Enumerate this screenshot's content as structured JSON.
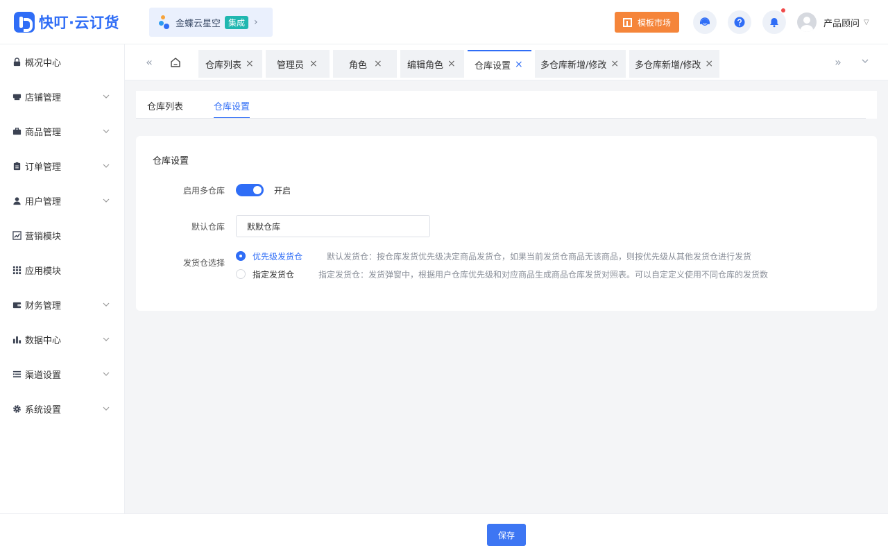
{
  "header": {
    "brand": "快叮·云订货",
    "integration": {
      "name": "金蝶云星空",
      "badge": "集成"
    },
    "template_market": "模板市场",
    "user_name": "产品顾问",
    "colors": {
      "brand": "#2f6df6",
      "template_button": "#f5853a",
      "integration_badge": "#20b7b0"
    }
  },
  "sidebar": {
    "items": [
      {
        "label": "概况中心",
        "icon": "lock-icon",
        "expandable": false
      },
      {
        "label": "店铺管理",
        "icon": "shop-icon",
        "expandable": true
      },
      {
        "label": "商品管理",
        "icon": "briefcase-icon",
        "expandable": true
      },
      {
        "label": "订单管理",
        "icon": "clipboard-icon",
        "expandable": true
      },
      {
        "label": "用户管理",
        "icon": "user-icon",
        "expandable": true
      },
      {
        "label": "营销模块",
        "icon": "trend-chart-icon",
        "expandable": false
      },
      {
        "label": "应用模块",
        "icon": "grid-icon",
        "expandable": false
      },
      {
        "label": "财务管理",
        "icon": "wallet-icon",
        "expandable": true
      },
      {
        "label": "数据中心",
        "icon": "bar-chart-icon",
        "expandable": true
      },
      {
        "label": "渠道设置",
        "icon": "list-icon",
        "expandable": true
      },
      {
        "label": "系统设置",
        "icon": "gear-icon",
        "expandable": true
      }
    ]
  },
  "tabs": {
    "items": [
      {
        "label": "仓库列表",
        "active": false
      },
      {
        "label": "管理员",
        "active": false
      },
      {
        "label": "角色",
        "active": false
      },
      {
        "label": "编辑角色",
        "active": false
      },
      {
        "label": "仓库设置",
        "active": true
      },
      {
        "label": "多仓库新增/修改",
        "active": false
      },
      {
        "label": "多仓库新增/修改",
        "active": false
      }
    ]
  },
  "subtabs": {
    "items": [
      {
        "label": "仓库列表",
        "active": false
      },
      {
        "label": "仓库设置",
        "active": true
      }
    ]
  },
  "settings": {
    "title": "仓库设置",
    "multi_warehouse": {
      "label": "启用多仓库",
      "enabled": true,
      "state_text": "开启"
    },
    "default_warehouse": {
      "label": "默认仓库",
      "value": "默默仓库"
    },
    "shipping_selection": {
      "label": "发货仓选择",
      "options": [
        {
          "label": "优先级发货仓",
          "checked": true,
          "description": "默认发货仓：按仓库发货优先级决定商品发货仓，如果当前发货仓商品无该商品，则按优先级从其他发货仓进行发货"
        },
        {
          "label": "指定发货仓",
          "checked": false,
          "description": "指定发货仓：发货弹窗中，根据用户仓库优先级和对应商品生成商品仓库发货对照表。可以自定定义使用不同仓库的发货数"
        }
      ]
    }
  },
  "footer": {
    "save_label": "保存"
  }
}
